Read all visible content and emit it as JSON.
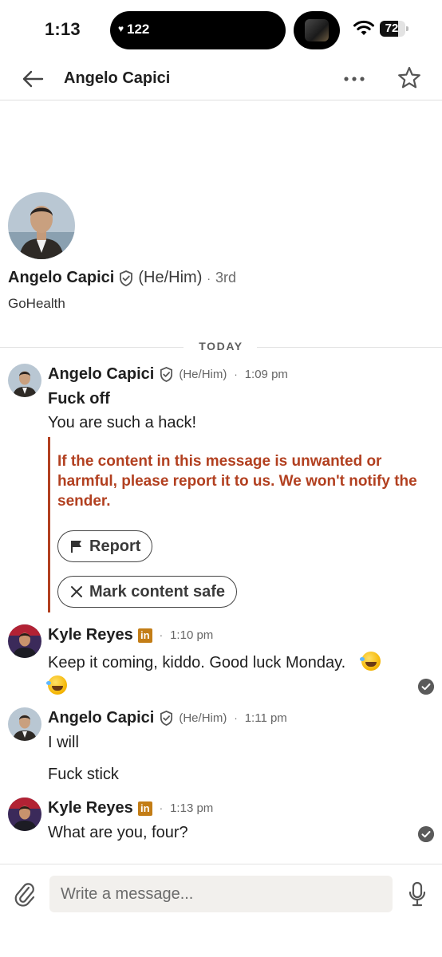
{
  "status_bar": {
    "time": "1:13",
    "activity_count": "122",
    "battery_level": "72",
    "battery_fraction": 0.72
  },
  "header": {
    "title": "Angelo Capici",
    "icons": [
      "back-arrow-icon",
      "more-dots-icon",
      "star-icon"
    ]
  },
  "profile": {
    "name": "Angelo Capici",
    "pronouns": "(He/Him)",
    "separator": "·",
    "degree": "3rd",
    "company": "GoHealth"
  },
  "day_divider": "TODAY",
  "messages": [
    {
      "sender": "Angelo Capici",
      "pronouns": "(He/Him)",
      "separator": "·",
      "time": "1:09 pm",
      "lines": [
        "Fuck off",
        "You are such a hack!"
      ],
      "warning": {
        "text": "If the content in this message is unwanted or harmful, please report it to us. We won't notify the sender.",
        "report_label": "Report",
        "safe_label": "Mark content safe"
      }
    },
    {
      "sender": "Kyle Reyes",
      "badge": "in",
      "separator": "·",
      "time": "1:10 pm",
      "lines": [
        "Keep it coming, kiddo.  Good luck Monday."
      ]
    },
    {
      "sender": "Angelo Capici",
      "pronouns": "(He/Him)",
      "separator": "·",
      "time": "1:11 pm",
      "lines": [
        "I will",
        "Fuck stick"
      ]
    },
    {
      "sender": "Kyle Reyes",
      "badge": "in",
      "separator": "·",
      "time": "1:13 pm",
      "lines": [
        "What are you, four?"
      ]
    }
  ],
  "composer": {
    "placeholder": "Write a message..."
  },
  "colors": {
    "warning": "#b24020",
    "linkedin_badge": "#c37d16",
    "input_bg": "#f2f0ed"
  }
}
